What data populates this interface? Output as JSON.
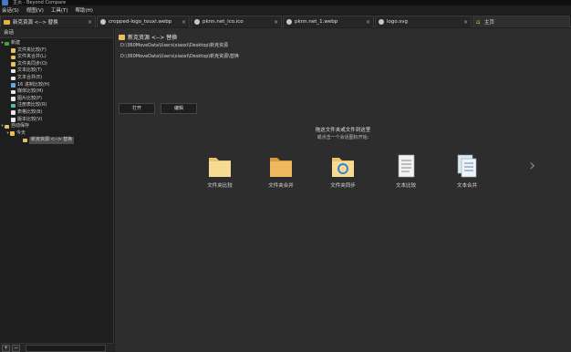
{
  "window": {
    "title": "主页 - Beyond Compare"
  },
  "menu": [
    "会话(S)",
    "视图(V)",
    "工具(T)",
    "帮助(H)"
  ],
  "tabs": [
    {
      "label": "新克资源 <--> 替换",
      "icon": "folder-compare-icon"
    },
    {
      "label": "cropped-logo_touxi.webp",
      "icon": "picture-compare-icon"
    },
    {
      "label": "pknn.net_ico.ico",
      "icon": "picture-compare-icon"
    },
    {
      "label": "pknn.net_1.webp",
      "icon": "picture-compare-icon"
    },
    {
      "label": "logo.svg",
      "icon": "picture-compare-icon"
    },
    {
      "label": "主页",
      "icon": "home-icon"
    }
  ],
  "sidebar": {
    "header": "会话",
    "tree": {
      "new_group": "新建",
      "new_items": [
        "文件夹比较(F)",
        "文件夹合并(L)",
        "文件夹同步(O)",
        "文本比较(T)",
        "文本合并(E)",
        "16 进制比较(H)",
        "媒体比较(M)",
        "图片比较(P)",
        "注册表比较(R)",
        "表格比较(B)",
        "版本比较(V)"
      ],
      "auto_saved": "自动保存",
      "today": "今天",
      "session": "新克资源 <--> 替换"
    },
    "footer": {
      "add": "+",
      "remove": "−"
    }
  },
  "main": {
    "session_title": "新克资源 <--> 替换",
    "left_path": "D:\\360MoveData\\Users\\xiaoxi\\Desktop\\新克资源",
    "right_path": "D:\\360MoveData\\Users\\xiaoxi\\Desktop\\新克资源\\替换",
    "open_button": "打开",
    "edit_button": "编辑",
    "hint_line1": "拖这文件夹或文件到这里",
    "hint_line2": "或点击一个会话图标开始:",
    "shortcuts": [
      "文件夹比较",
      "文件夹合并",
      "文件夹同步",
      "文本比较",
      "文本合并"
    ]
  }
}
